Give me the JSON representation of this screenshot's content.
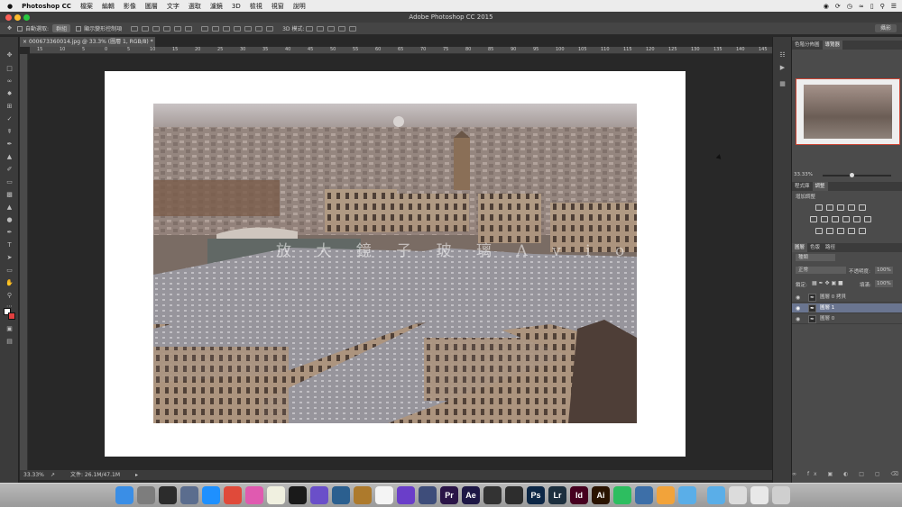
{
  "menubar": {
    "apple": "",
    "app_name": "Photoshop CC",
    "items": [
      "檔案",
      "編輯",
      "影像",
      "圖層",
      "文字",
      "選取",
      "濾鏡",
      "3D",
      "檢視",
      "視窗",
      "說明"
    ]
  },
  "window": {
    "title": "Adobe Photoshop CC 2015",
    "traffic_colors": [
      "#fc5f57",
      "#fdbc2e",
      "#28c840"
    ]
  },
  "options_bar": {
    "auto_select_label": "自動選取:",
    "auto_select_value": "群組",
    "show_transform_label": "顯示變形控制項",
    "mode_3d_label": "3D 模式:",
    "workspace": "攝影"
  },
  "document": {
    "tab_title": "000673360014.jpg @ 33.3% (圖層 1, RGB/8) *",
    "close_glyph": "×",
    "ruler_ticks": [
      "15",
      "10",
      "5",
      "0",
      "5",
      "10",
      "15",
      "20",
      "25",
      "30",
      "35",
      "40",
      "45",
      "50",
      "55",
      "60",
      "65",
      "70",
      "75",
      "80",
      "85",
      "90",
      "95",
      "100",
      "105",
      "110",
      "115",
      "120",
      "125",
      "130",
      "135",
      "140",
      "145"
    ],
    "watermark_text": "放 大 鏡 子 玻 璃 A v i o"
  },
  "status": {
    "zoom": "33.33%",
    "doc_info": "文件: 26.1M/47.1M"
  },
  "navigator": {
    "tabs": [
      "色階分佈圖",
      "導覽器"
    ],
    "active_tab": "導覽器",
    "zoom": "33.33%"
  },
  "adjustments": {
    "tabs": [
      "程式庫",
      "調整"
    ],
    "active_tab": "調整",
    "header": "增加調整"
  },
  "layers": {
    "tabs": [
      "圖層",
      "色版",
      "路徑"
    ],
    "active_tab": "圖層",
    "filter_kind": "種類",
    "blend_mode": "正常",
    "opacity_label": "不透明度:",
    "opacity_value": "100%",
    "lock_label": "鎖定:",
    "fill_label": "填滿:",
    "fill_value": "100%",
    "list": [
      {
        "name": "圖層 0 拷貝",
        "active": false
      },
      {
        "name": "圖層 1",
        "active": true
      },
      {
        "name": "圖層 0",
        "active": false
      }
    ]
  },
  "dock": {
    "apps": [
      {
        "name": "finder",
        "label": "",
        "color": "#3a8ee6"
      },
      {
        "name": "system-preferences",
        "label": "",
        "color": "#7d7d7d"
      },
      {
        "name": "dashboard",
        "label": "",
        "color": "#2c2c2c"
      },
      {
        "name": "launchpad",
        "label": "",
        "color": "#5b6d8e"
      },
      {
        "name": "safari",
        "label": "",
        "color": "#1e90ff"
      },
      {
        "name": "chrome",
        "label": "",
        "color": "#e04a3a"
      },
      {
        "name": "itunes",
        "label": "",
        "color": "#e05ab0"
      },
      {
        "name": "notes",
        "label": "",
        "color": "#f0f0e0"
      },
      {
        "name": "activity-monitor",
        "label": "",
        "color": "#1a1a1a"
      },
      {
        "name": "siri",
        "label": "",
        "color": "#6a4fc9"
      },
      {
        "name": "quicktime",
        "label": "",
        "color": "#2b5f8f"
      },
      {
        "name": "keynote",
        "label": "",
        "color": "#ad7a2c"
      },
      {
        "name": "photos-app",
        "label": "",
        "color": "#f4f4f4"
      },
      {
        "name": "imovie",
        "label": "",
        "color": "#6a3ec9"
      },
      {
        "name": "preview",
        "label": "",
        "color": "#3e4d7a"
      },
      {
        "name": "premiere",
        "label": "Pr",
        "color": "#2a1447"
      },
      {
        "name": "after-effects",
        "label": "Ae",
        "color": "#1d1745"
      },
      {
        "name": "final-cut",
        "label": "",
        "color": "#333"
      },
      {
        "name": "davinci",
        "label": "",
        "color": "#2d2d2d"
      },
      {
        "name": "photoshop",
        "label": "Ps",
        "color": "#0c2746"
      },
      {
        "name": "lightroom",
        "label": "Lr",
        "color": "#1c2f3e"
      },
      {
        "name": "indesign",
        "label": "Id",
        "color": "#46001f"
      },
      {
        "name": "illustrator",
        "label": "Ai",
        "color": "#2a1300"
      },
      {
        "name": "evernote",
        "label": "",
        "color": "#2dbe60"
      },
      {
        "name": "screen-sharing",
        "label": "",
        "color": "#3d6fa8"
      },
      {
        "name": "pages",
        "label": "",
        "color": "#f2a33a"
      },
      {
        "name": "downloads-folder",
        "label": "",
        "color": "#5aaee8"
      },
      {
        "name": "documents-folder",
        "label": "",
        "color": "#5aaee8"
      },
      {
        "name": "drive",
        "label": "",
        "color": "#dcdcdc"
      },
      {
        "name": "app-store-folder",
        "label": "",
        "color": "#e8e8e8"
      },
      {
        "name": "trash",
        "label": "",
        "color": "#cfcfcf"
      }
    ]
  }
}
